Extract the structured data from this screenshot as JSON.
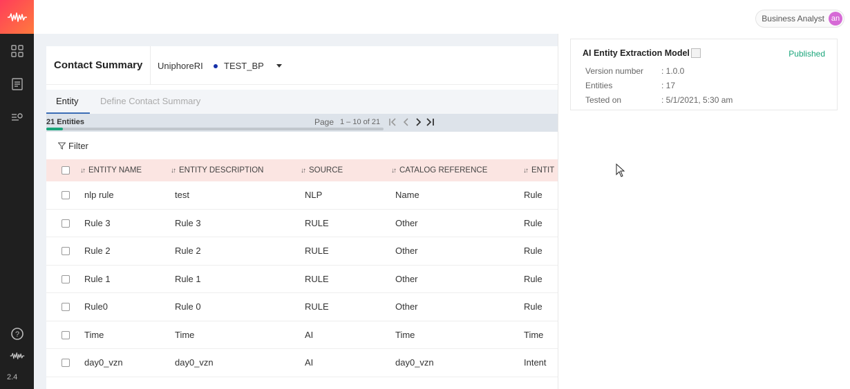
{
  "app": {
    "version": "2.4",
    "user": {
      "role": "Business Analyst",
      "initials": "an"
    }
  },
  "header": {
    "title": "Contact Summary",
    "project": "UniphoreRI",
    "environment": "TEST_BP",
    "environment_dot_color": "#1530a8"
  },
  "tabs": [
    {
      "label": "Entity",
      "active": true
    },
    {
      "label": "Define Contact Summary",
      "active": false
    }
  ],
  "pager": {
    "entity_count": "21 Entities",
    "page_label": "Page",
    "range": "1 – 10 of 21",
    "progress": 0.05
  },
  "filter_label": "Filter",
  "table": {
    "columns": [
      "ENTITY NAME",
      "ENTITY DESCRIPTION",
      "SOURCE",
      "CATALOG REFERENCE",
      "ENTIT"
    ],
    "rows": [
      [
        "nlp rule",
        "test",
        "NLP",
        "Name",
        "Rule"
      ],
      [
        "Rule 3",
        "Rule 3",
        "RULE",
        "Other",
        "Rule"
      ],
      [
        "Rule 2",
        "Rule 2",
        "RULE",
        "Other",
        "Rule"
      ],
      [
        "Rule 1",
        "Rule 1",
        "RULE",
        "Other",
        "Rule"
      ],
      [
        "Rule0",
        "Rule 0",
        "RULE",
        "Other",
        "Rule"
      ],
      [
        "Time",
        "Time",
        "AI",
        "Time",
        "Time"
      ],
      [
        "day0_vzn",
        "day0_vzn",
        "AI",
        "day0_vzn",
        "Intent"
      ]
    ]
  },
  "model_panel": {
    "title": "AI Entity Extraction Model",
    "status": "Published",
    "status_color": "#1aa57a",
    "fields": [
      {
        "label": "Version number",
        "value": ": 1.0.0"
      },
      {
        "label": "Entities",
        "value": ": 17"
      },
      {
        "label": "Tested on",
        "value": ": 5/1/2021, 5:30 am"
      }
    ]
  },
  "colors": {
    "brand_gradient_start": "#ff3d5a",
    "brand_gradient_end": "#ff7a3d",
    "rail": "#1f1f1f",
    "table_header": "#fbe5e2",
    "accent": "#3a6db5"
  },
  "icons": [
    "waveform-logo-icon",
    "grid-icon",
    "document-icon",
    "settings-list-icon",
    "help-icon",
    "waveform-icon",
    "filter-icon",
    "sort-icon",
    "first-page-icon",
    "prev-page-icon",
    "next-page-icon",
    "last-page-icon"
  ]
}
